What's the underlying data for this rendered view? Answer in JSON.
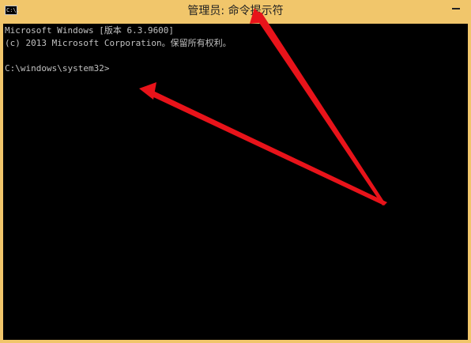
{
  "window": {
    "title": "管理员: 命令提示符",
    "icon_name": "console-icon",
    "icon_text": "C:\\.",
    "minimize_label": "—"
  },
  "console": {
    "lines": [
      "Microsoft Windows [版本 6.3.9600]",
      "(c) 2013 Microsoft Corporation。保留所有权利。",
      "C:\\windows\\system32>"
    ]
  },
  "colors": {
    "titlebar": "#f1c66b",
    "console_bg": "#000000",
    "console_fg": "#c0c0c0",
    "annotation_arrow": "#e8131a"
  }
}
